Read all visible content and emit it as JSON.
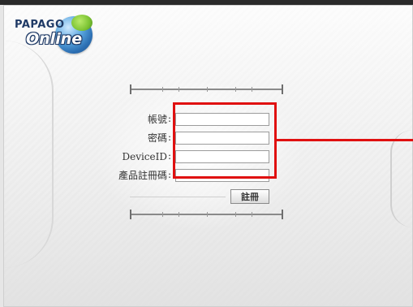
{
  "logo": {
    "line1": "PAPAGO",
    "line2": "Online"
  },
  "form": {
    "account_label": "帳號",
    "password_label": "密碼",
    "device_label": "DeviceID",
    "reg_code_label": "產品註冊碼",
    "colon": ":",
    "account_value": "",
    "password_value": "",
    "device_value": "",
    "reg_code_value": "",
    "submit_label": "註冊"
  },
  "colors": {
    "highlight": "#e01010"
  },
  "icons": {
    "logo_globe": "globe-icon"
  }
}
